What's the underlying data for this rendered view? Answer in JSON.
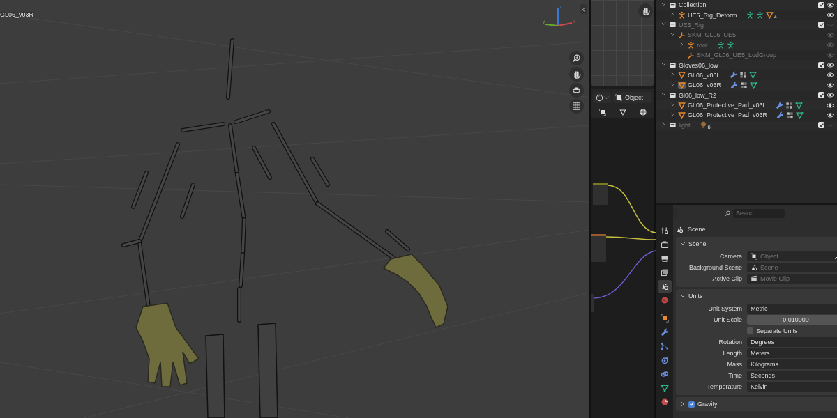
{
  "viewport": {
    "object_label": "GL06_v03R",
    "axis_labels": [
      "z",
      "y",
      "x"
    ]
  },
  "node_editor": {
    "mode": "Object"
  },
  "outliner": {
    "items": [
      {
        "kind": "collection",
        "name": "Collection",
        "expanded": true,
        "disabled": false,
        "checked": true,
        "visible": true,
        "children": [
          {
            "kind": "armature",
            "name": "UE5_Rig_Deform",
            "expanded": false,
            "disabled": false,
            "visible": true,
            "extras": [
              {
                "kind": "pose"
              },
              {
                "kind": "pose"
              },
              {
                "kind": "mesh",
                "count": "4"
              }
            ]
          }
        ]
      },
      {
        "kind": "collection",
        "name": "UE5_Rig",
        "expanded": true,
        "disabled": true,
        "checked": true,
        "visible": false,
        "children": [
          {
            "kind": "armature_data",
            "name": "SKM_GL06_UE5",
            "expanded": true,
            "disabled": true,
            "visible": true,
            "children": [
              {
                "kind": "armature",
                "name": "root",
                "expanded": false,
                "disabled": true,
                "visible": true,
                "extras": [
                  {
                    "kind": "pose"
                  },
                  {
                    "kind": "pose"
                  }
                ]
              },
              {
                "kind": "armature_data",
                "name": "SKM_GL06_UE5_LodGroup",
                "disabled": true,
                "visible": true
              }
            ]
          }
        ]
      },
      {
        "kind": "collection",
        "name": "Gloves06_low",
        "expanded": true,
        "disabled": false,
        "checked": true,
        "visible": true,
        "children": [
          {
            "kind": "mesh",
            "name": "GL06_v03L",
            "expanded": false,
            "disabled": false,
            "active": false,
            "visible": true,
            "extras": [
              {
                "kind": "modifier"
              },
              {
                "kind": "vgroups"
              },
              {
                "kind": "meshdata"
              }
            ]
          },
          {
            "kind": "mesh",
            "name": "GL06_v03R",
            "expanded": false,
            "disabled": false,
            "active": true,
            "visible": true,
            "extras": [
              {
                "kind": "modifier"
              },
              {
                "kind": "vgroups"
              },
              {
                "kind": "meshdata"
              }
            ]
          }
        ]
      },
      {
        "kind": "collection",
        "name": "Gl06_low_R2",
        "expanded": true,
        "disabled": false,
        "checked": true,
        "visible": true,
        "children": [
          {
            "kind": "mesh",
            "name": "GL06_Protective_Pad_v03L",
            "expanded": false,
            "disabled": false,
            "visible": true,
            "extras": [
              {
                "kind": "modifier"
              },
              {
                "kind": "vgroups"
              },
              {
                "kind": "meshdata"
              }
            ]
          },
          {
            "kind": "mesh",
            "name": "GL06_Protective_Pad_v03R",
            "expanded": false,
            "disabled": false,
            "visible": true,
            "extras": [
              {
                "kind": "modifier"
              },
              {
                "kind": "vgroups"
              },
              {
                "kind": "meshdata"
              }
            ]
          }
        ]
      },
      {
        "kind": "collection",
        "name": "light",
        "expanded": false,
        "disabled": true,
        "checked": true,
        "visible": false,
        "extras": [
          {
            "kind": "light",
            "count": "6"
          }
        ]
      }
    ]
  },
  "properties": {
    "search": {
      "placeholder": "Search"
    },
    "tabs": [
      {
        "kind": "tool",
        "selected": false
      },
      {
        "kind": "render",
        "selected": false
      },
      {
        "kind": "output",
        "selected": false
      },
      {
        "kind": "view_layer",
        "selected": false
      },
      {
        "kind": "scene",
        "selected": true
      },
      {
        "kind": "world",
        "selected": false
      },
      {
        "kind": "object",
        "selected": false
      },
      {
        "kind": "modifier",
        "selected": false
      },
      {
        "kind": "particles",
        "selected": false
      },
      {
        "kind": "physics",
        "selected": false
      },
      {
        "kind": "constraints",
        "selected": false
      },
      {
        "kind": "data",
        "selected": false
      },
      {
        "kind": "material",
        "selected": false
      }
    ],
    "context": "Scene",
    "panels": [
      {
        "title": "Scene",
        "expanded": true,
        "rows": [
          {
            "kind": "id",
            "label": "Camera",
            "placeholder": "Object",
            "picker": true
          },
          {
            "kind": "id",
            "label": "Background Scene",
            "placeholder": "Scene"
          },
          {
            "kind": "id",
            "label": "Active Clip",
            "placeholder": "Movie Clip"
          }
        ]
      },
      {
        "title": "Units",
        "expanded": true,
        "rows": [
          {
            "kind": "dropdown",
            "label": "Unit System",
            "value": "Metric"
          },
          {
            "kind": "number",
            "label": "Unit Scale",
            "value": "0.010000"
          },
          {
            "kind": "checkbox",
            "label": "Separate Units",
            "checked": false
          },
          {
            "kind": "dropdown",
            "label": "Rotation",
            "value": "Degrees"
          },
          {
            "kind": "dropdown",
            "label": "Length",
            "value": "Meters"
          },
          {
            "kind": "dropdown",
            "label": "Mass",
            "value": "Kilograms"
          },
          {
            "kind": "dropdown",
            "label": "Time",
            "value": "Seconds"
          },
          {
            "kind": "dropdown",
            "label": "Temperature",
            "value": "Kelvin"
          }
        ]
      },
      {
        "title": "Gravity",
        "expanded": false,
        "checked": true
      }
    ]
  }
}
